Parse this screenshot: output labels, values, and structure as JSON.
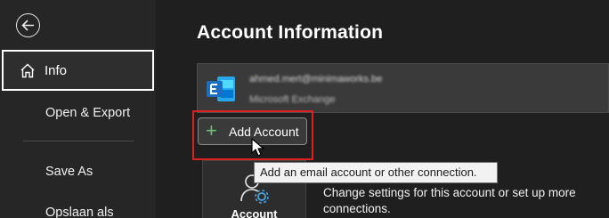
{
  "sidebar": {
    "back_icon": "back-arrow-icon",
    "items": [
      {
        "label": "Info",
        "icon": "home-icon",
        "selected": true
      },
      {
        "label": "Open & Export"
      },
      {
        "label": "Save As"
      },
      {
        "label": "Opslaan als"
      }
    ]
  },
  "main": {
    "title": "Account Information",
    "account": {
      "email": "ahmed.mert@minimaworks.be",
      "type": "Microsoft Exchange",
      "icon": "exchange-icon"
    },
    "add_account": {
      "label": "Add Account",
      "icon": "plus-icon"
    },
    "tooltip": "Add an email account or other connection.",
    "account_settings": {
      "tile_label": "Account",
      "description": "Change settings for this account or set up more connections."
    }
  },
  "colors": {
    "highlight": "#e0201f",
    "plus": "#6fbf73",
    "exchange_blue": "#1b6fc2"
  }
}
